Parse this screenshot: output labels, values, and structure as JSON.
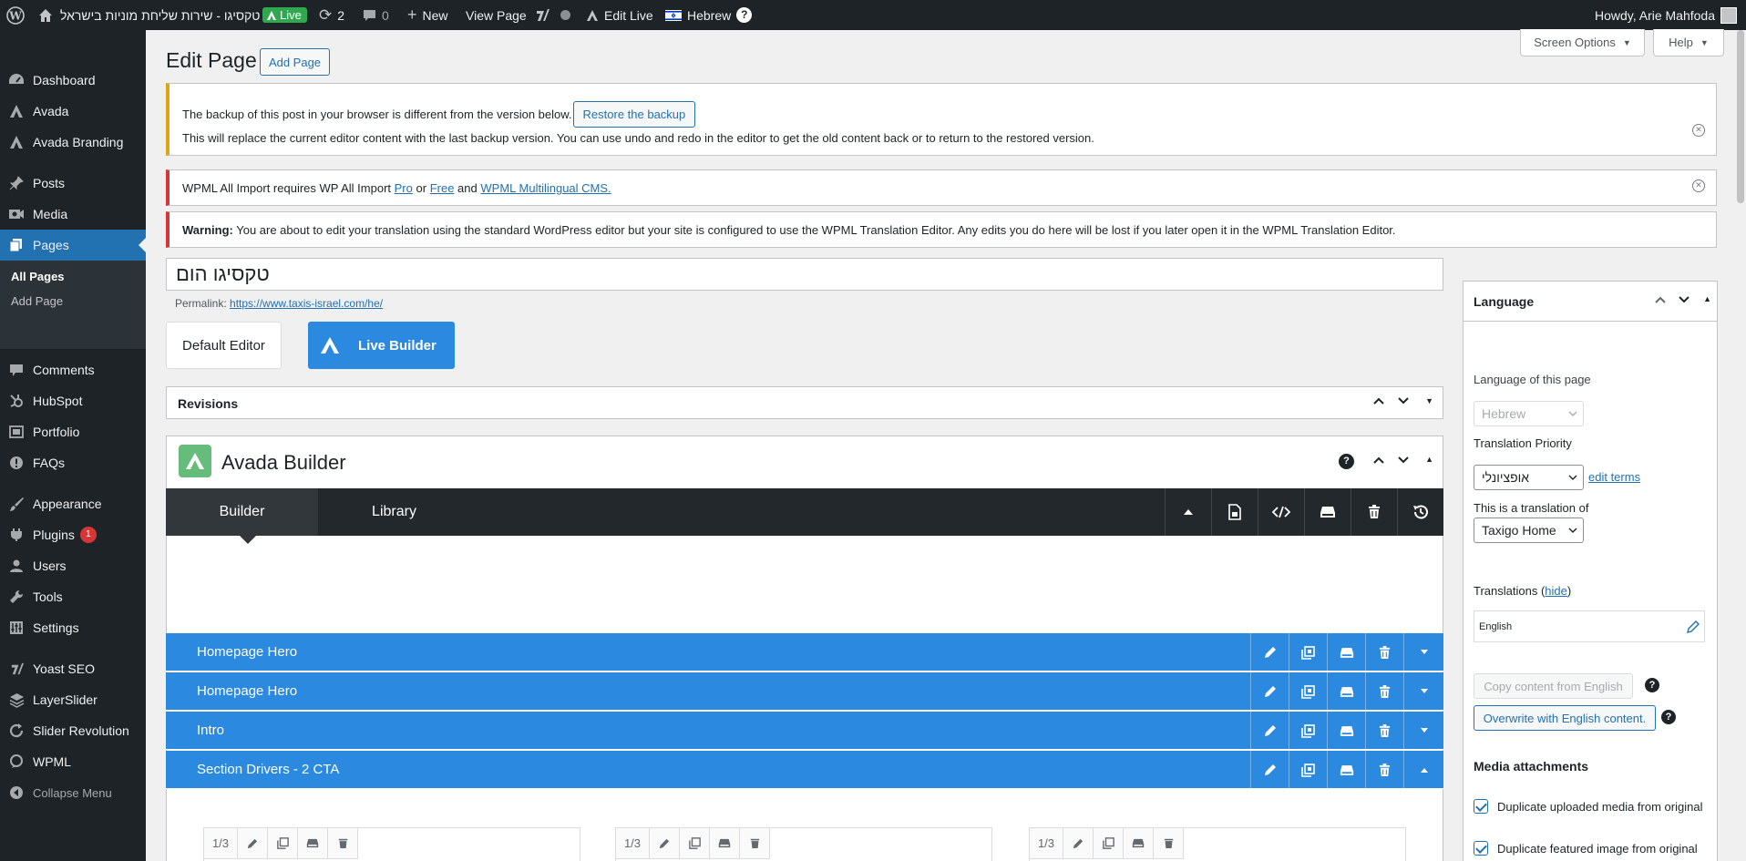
{
  "adminbar": {
    "site_name": "טקסיגו - שירות שליחת מוניות בישראל",
    "live_label": "Live",
    "updates_count": "2",
    "comments_count": "0",
    "new_label": "New",
    "view_page_label": "View Page",
    "edit_live_label": "Edit Live",
    "language_label": "Hebrew",
    "howdy": "Howdy, Arie Mahfoda"
  },
  "sidebar": {
    "dashboard": "Dashboard",
    "avada": "Avada",
    "avada_branding": "Avada Branding",
    "posts": "Posts",
    "media": "Media",
    "pages": "Pages",
    "all_pages": "All Pages",
    "add_page": "Add Page",
    "comments": "Comments",
    "hubspot": "HubSpot",
    "portfolio": "Portfolio",
    "faqs": "FAQs",
    "appearance": "Appearance",
    "plugins": "Plugins",
    "plugins_badge": "1",
    "users": "Users",
    "tools": "Tools",
    "settings": "Settings",
    "yoast": "Yoast SEO",
    "layerslider": "LayerSlider",
    "slider_revolution": "Slider Revolution",
    "wpml": "WPML",
    "collapse": "Collapse Menu"
  },
  "header": {
    "title": "Edit Page",
    "add_page": "Add Page",
    "screen_options": "Screen Options",
    "help": "Help"
  },
  "notices": {
    "backup_text": "The backup of this post in your browser is different from the version below.",
    "restore_button": "Restore the backup",
    "backup_detail": "This will replace the current editor content with the last backup version. You can use undo and redo in the editor to get the old content back or to return to the restored version.",
    "wpml_import_prefix": "WPML All Import requires WP All Import",
    "pro": "Pro",
    "or": "or",
    "free": "Free",
    "and": "and",
    "wpml_cms": "WPML Multilingual CMS.",
    "warning_label": "Warning:",
    "warning_text": "You are about to edit your translation using the standard WordPress editor but your site is configured to use the WPML Translation Editor. Any edits you do here will be lost if you later open it in the WPML Translation Editor."
  },
  "editor": {
    "title_value": "טקסיגו הום",
    "permalink_label": "Permalink:",
    "permalink_url": "https://www.taxis-israel.com/he/",
    "default_editor": "Default Editor",
    "live_builder": "Live Builder",
    "revisions": "Revisions",
    "avada_builder": "Avada Builder",
    "tab_builder": "Builder",
    "tab_library": "Library"
  },
  "containers": [
    {
      "title": "Homepage Hero"
    },
    {
      "title": "Homepage Hero"
    },
    {
      "title": "Intro"
    },
    {
      "title": "Section Drivers - 2 CTA"
    }
  ],
  "columns": [
    {
      "size": "1/3"
    },
    {
      "size": "1/3"
    },
    {
      "size": "1/3"
    }
  ],
  "language_panel": {
    "title": "Language",
    "language_of_page": "Language of this page",
    "language_value": "Hebrew",
    "translation_priority": "Translation Priority",
    "priority_value": "אופציונלי",
    "edit_terms": "edit terms",
    "translation_of": "This is a translation of",
    "translation_of_value": "Taxigo Home",
    "translations_label": "Translations",
    "hide": "hide",
    "english": "English",
    "copy_content": "Copy content from English",
    "overwrite": "Overwrite with English content.",
    "media_attachments": "Media attachments",
    "dup_media": "Duplicate uploaded media from original",
    "dup_featured": "Duplicate featured image from original"
  },
  "colors": {
    "admin_dark": "#1d2327",
    "wp_blue": "#2271b1",
    "avada_blue": "#2b8ae0",
    "avada_green": "#65bc7b",
    "notice_yellow": "#dba617",
    "notice_red": "#d63638"
  }
}
